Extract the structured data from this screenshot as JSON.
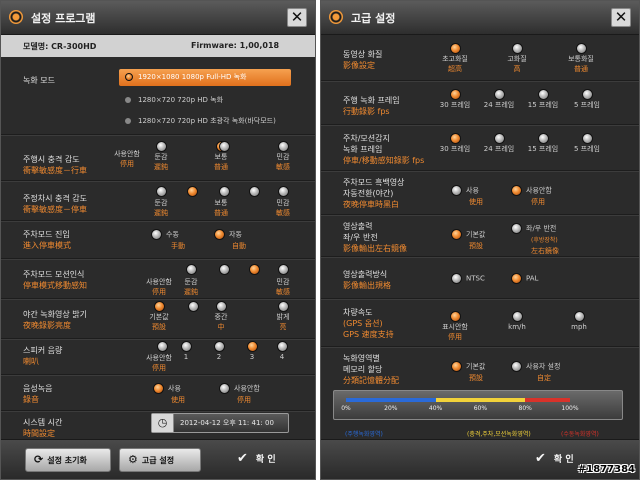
{
  "left": {
    "title": "설정 프로그램",
    "model_label": "모델명: CR-300HD",
    "firmware_label": "Firmware: 1,00,018",
    "rec_mode": {
      "label": "녹화 모드",
      "selected": "1920×1080 1080p Full-HD 녹화",
      "opt2": "1280×720 720p HD 녹화",
      "opt3": "1280×720 720p HD 초광각 녹화(바닥모드)"
    },
    "drive_shock": {
      "label": "주행시 충격 감도",
      "cn": "衝擊敏感度－行車",
      "o1": "사용안함",
      "o1cn": "停用",
      "o2": "둔감",
      "o2cn": "遲鈍",
      "o3": "보통",
      "o3cn": "普通",
      "o4": "민감",
      "o4cn": "敏感"
    },
    "park_shock": {
      "label": "주정차시 충격 감도",
      "cn": "衝擊敏感度－停車",
      "o2": "둔감",
      "o2cn": "遲鈍",
      "o3": "보통",
      "o3cn": "普通",
      "o4": "민감",
      "o4cn": "敏感"
    },
    "park_enter": {
      "label": "주차모드 진입",
      "cn": "進入停車模式",
      "o1": "수동",
      "o1cn": "手動",
      "o2": "자동",
      "o2cn": "自動"
    },
    "park_motion": {
      "label": "주차모드 모션인식",
      "cn": "停車模式移動感知",
      "o1": "사용안함",
      "o1cn": "停用",
      "o2": "둔감",
      "o2cn": "遲鈍",
      "o4": "민감",
      "o4cn": "敏感"
    },
    "night_bright": {
      "label": "야간 녹화영상 밝기",
      "cn": "夜晚錄影亮度",
      "o1": "기본값",
      "o1cn": "預設",
      "o2": "중간",
      "o2cn": "中",
      "o3": "밝게",
      "o3cn": "亮"
    },
    "speaker": {
      "label": "스피커 음량",
      "cn": "喇叭",
      "o1": "사용안함",
      "o1cn": "停用",
      "o2": "1",
      "o3": "2",
      "o4": "3",
      "o5": "4"
    },
    "audio_rec": {
      "label": "음성녹음",
      "cn": "錄音",
      "o1": "사용",
      "o1cn": "使用",
      "o2": "사용안함",
      "o2cn": "停用"
    },
    "sys_time": {
      "label": "시스템 시간",
      "cn": "時間設定",
      "value": "2012-04-12 오후 11: 41: 00"
    },
    "btn_reset": "설정 초기화",
    "btn_advanced": "고급 설정",
    "btn_ok": "확 인"
  },
  "right": {
    "title": "고급 설정",
    "video_quality": {
      "label": "동영상 화질",
      "cn": "影像設定",
      "o1": "초고화질",
      "o1cn": "超高",
      "o2": "고화질",
      "o2cn": "高",
      "o3": "보통화질",
      "o3cn": "普通"
    },
    "drive_fps": {
      "label": "주행 녹화 프레임",
      "cn": "行動錄影 fps",
      "o1": "30 프레임",
      "o2": "24 프레임",
      "o3": "15 프레임",
      "o4": "5 프레임"
    },
    "park_fps": {
      "label": "주차/모션감지",
      "label2": "녹화 프레임",
      "cn": "停車/移動感知錄影 fps",
      "o1": "30 프레임",
      "o2": "24 프레임",
      "o3": "15 프레임",
      "o4": "5 프레임"
    },
    "night_switch": {
      "label": "주차모드 흑백영상",
      "label2": "자동전환(야간)",
      "cn": "夜晚停車時黑白",
      "o1": "사용",
      "o1cn": "使用",
      "o2": "사용안함",
      "o2cn": "停用"
    },
    "mirror": {
      "label": "영상출력",
      "label2": "좌/우 반전",
      "cn": "影像輸出左右鏡像",
      "o1": "기본값",
      "o1cn": "預設",
      "o2": "좌/우 반전",
      "o2sub": "(후방장착)",
      "o2cn": "左右鏡像"
    },
    "output_std": {
      "label": "영상출력방식",
      "cn": "影像輸出規格",
      "o1": "NTSC",
      "o2": "PAL"
    },
    "speed": {
      "label": "차량속도",
      "label_sub": "(GPS 옵션)",
      "cn": "GPS 速度支持",
      "o1": "표시안함",
      "o1cn": "停用",
      "o2": "km/h",
      "o3": "mph"
    },
    "mem_alloc": {
      "label": "녹화영역별",
      "label2": "메모리 할당",
      "cn": "分類記憶體分配",
      "o1": "기본값",
      "o1cn": "預設",
      "o2": "사용자 설정",
      "o2cn": "自定"
    },
    "bar": {
      "ticks": [
        "0%",
        "20%",
        "40%",
        "60%",
        "80%",
        "100%"
      ],
      "blue_pct": 40,
      "yellow_pct": 40,
      "red_pct": 20
    },
    "legend1": "(주행녹화영역)",
    "legend2": "(충격,주차,모션녹화영역)",
    "legend3": "(수동녹화영역)",
    "btn_ok": "확 인",
    "colors": {
      "blue": "#2a6ad8",
      "yellow": "#f2d23a",
      "red": "#d8322a",
      "accent": "#f08a30"
    }
  },
  "watermark": "#1877384"
}
